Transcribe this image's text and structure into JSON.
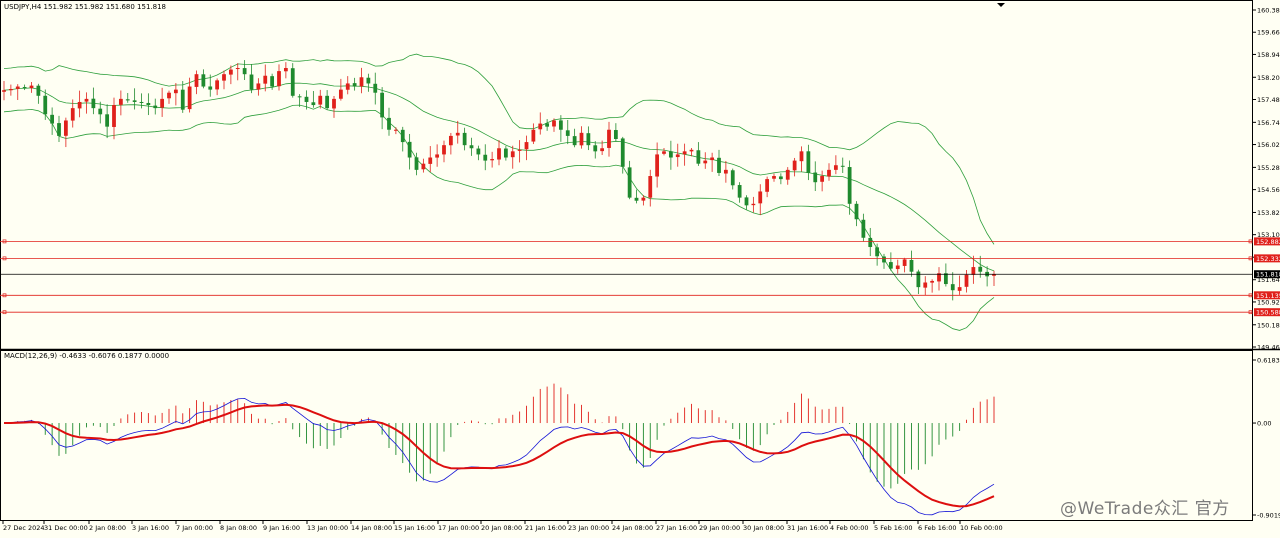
{
  "header": {
    "symbol_label": "USDJPY,H4  151.982 151.982 151.680 151.818"
  },
  "indicator": {
    "label": "MACD(12,26,9) -0.4633 -0.6076 0.1877 0.0000"
  },
  "watermark": "@WeTrade众汇 官方",
  "colors": {
    "background": "#fffff3",
    "bull_candle": "#e0211b",
    "bear_candle": "#1f8a2e",
    "bollinger": "#2e9f3c",
    "level_line": "#e0211b",
    "current_line": "#000000",
    "macd_line": "#1414d6",
    "signal_line": "#dd0f0f",
    "hist_pos": "#e0211b",
    "hist_neg": "#1f8a2e"
  },
  "chart_data": [
    {
      "type": "candlestick",
      "title": "USDJPY,H4",
      "ohlc_label": "151.982 151.982 151.680 151.818",
      "ylim": [
        149.46,
        160.38
      ],
      "y_ticks": [
        "160.380",
        "159.660",
        "158.940",
        "158.200",
        "157.480",
        "156.740",
        "156.020",
        "155.280",
        "154.560",
        "153.820",
        "153.100",
        "152.370",
        "151.640",
        "150.920",
        "150.180",
        "149.460"
      ],
      "x_ticks": [
        "27 Dec 2024",
        "31 Dec 00:00",
        "2 Jan 08:00",
        "3 Jan 16:00",
        "7 Jan 00:00",
        "8 Jan 08:00",
        "9 Jan 16:00",
        "13 Jan 00:00",
        "14 Jan 08:00",
        "15 Jan 16:00",
        "17 Jan 00:00",
        "20 Jan 08:00",
        "21 Jan 16:00",
        "23 Jan 00:00",
        "24 Jan 08:00",
        "27 Jan 16:00",
        "29 Jan 00:00",
        "30 Jan 08:00",
        "31 Jan 16:00",
        "4 Feb 00:00",
        "5 Feb 16:00",
        "6 Feb 16:00",
        "10 Feb 00:00"
      ],
      "horizontal_levels": [
        {
          "value": 152.882,
          "label": "152.882"
        },
        {
          "value": 152.332,
          "label": "152.332"
        },
        {
          "value": 151.135,
          "label": "151.135"
        },
        {
          "value": 150.588,
          "label": "150.588"
        }
      ],
      "current_price": {
        "value": 151.818,
        "label": "151.818"
      },
      "closes": [
        157.78,
        157.82,
        157.9,
        157.86,
        157.93,
        157.6,
        157.0,
        156.7,
        156.3,
        156.8,
        157.2,
        157.4,
        157.5,
        157.2,
        157.0,
        156.6,
        157.3,
        157.5,
        157.45,
        157.4,
        157.38,
        157.3,
        157.2,
        157.5,
        157.7,
        157.8,
        157.15,
        157.9,
        158.3,
        157.9,
        157.8,
        158.1,
        158.3,
        158.45,
        158.5,
        158.3,
        157.8,
        158.0,
        158.25,
        157.9,
        158.4,
        158.5,
        157.6,
        157.55,
        157.4,
        157.3,
        157.6,
        157.2,
        157.5,
        157.8,
        158.0,
        157.9,
        158.2,
        158.0,
        157.7,
        156.9,
        156.5,
        156.5,
        156.1,
        155.6,
        155.2,
        155.4,
        155.6,
        155.7,
        156.0,
        156.3,
        156.4,
        156.0,
        155.9,
        155.7,
        155.5,
        155.55,
        155.9,
        155.6,
        155.8,
        155.85,
        156.1,
        156.5,
        156.7,
        156.6,
        156.8,
        156.5,
        156.3,
        156.0,
        156.4,
        156.0,
        155.8,
        155.9,
        156.5,
        156.2,
        155.3,
        154.3,
        154.2,
        154.3,
        155.0,
        155.7,
        155.8,
        155.6,
        155.7,
        155.8,
        155.85,
        155.4,
        155.5,
        155.6,
        155.1,
        155.2,
        154.7,
        154.3,
        154.05,
        154.1,
        154.5,
        154.9,
        155.0,
        154.9,
        155.2,
        155.5,
        155.8,
        155.1,
        154.8,
        155.0,
        155.2,
        155.35,
        155.3,
        154.1,
        153.6,
        153.0,
        152.7,
        152.4,
        152.2,
        152.0,
        152.1,
        152.3,
        151.9,
        151.4,
        151.55,
        151.6,
        151.85,
        151.5,
        151.3,
        151.4,
        151.8,
        152.05,
        151.9,
        151.75,
        151.82
      ]
    },
    {
      "type": "line",
      "title": "MACD(12,26,9)",
      "values_label": "-0.4633 -0.6076 0.1877 0.0000",
      "ylim": [
        -0.9019,
        0.6183
      ],
      "y_ticks": [
        "0.6183",
        "0.00",
        "-0.9019"
      ]
    }
  ]
}
